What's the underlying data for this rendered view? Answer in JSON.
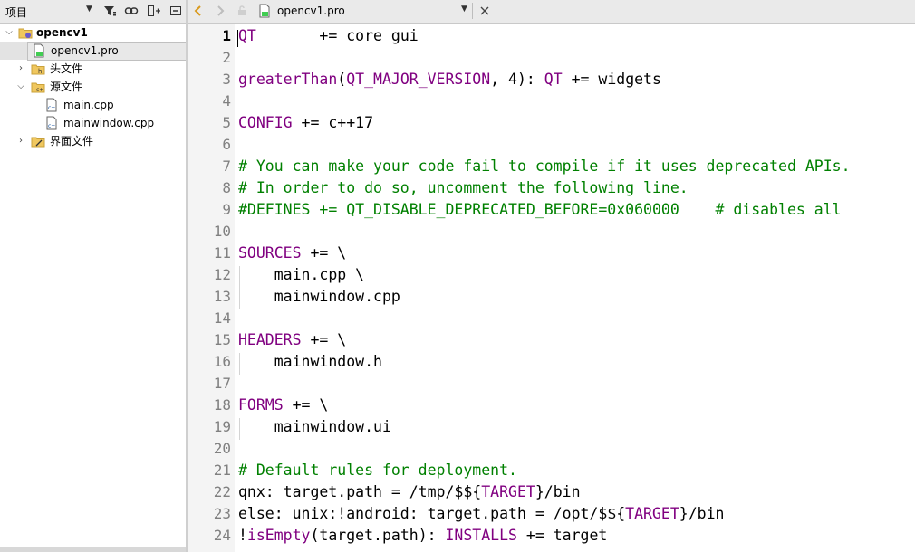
{
  "left_panel": {
    "title": "项目",
    "tree": [
      {
        "label": "opencv1"
      },
      {
        "label": "opencv1.pro"
      },
      {
        "label": "头文件"
      },
      {
        "label": "源文件"
      },
      {
        "label": "main.cpp"
      },
      {
        "label": "mainwindow.cpp"
      },
      {
        "label": "界面文件"
      }
    ]
  },
  "editor": {
    "filename": "opencv1.pro",
    "current_line": "1",
    "line_numbers": [
      "1",
      "2",
      "3",
      "4",
      "5",
      "6",
      "7",
      "8",
      "9",
      "10",
      "11",
      "12",
      "13",
      "14",
      "15",
      "16",
      "17",
      "18",
      "19",
      "20",
      "21",
      "22",
      "23",
      "24"
    ],
    "lines": [
      [
        {
          "t": "QT",
          "c": "kw"
        },
        {
          "t": "       += core gui",
          "c": ""
        }
      ],
      [],
      [
        {
          "t": "greaterThan",
          "c": "kw"
        },
        {
          "t": "(",
          "c": ""
        },
        {
          "t": "QT_MAJOR_VERSION",
          "c": "kw"
        },
        {
          "t": ", 4): ",
          "c": ""
        },
        {
          "t": "QT",
          "c": "kw"
        },
        {
          "t": " += widgets",
          "c": ""
        }
      ],
      [],
      [
        {
          "t": "CONFIG",
          "c": "kw"
        },
        {
          "t": " += c++17",
          "c": ""
        }
      ],
      [],
      [
        {
          "t": "# You can make your code fail to compile if it uses deprecated APIs.",
          "c": "cm"
        }
      ],
      [
        {
          "t": "# In order to do so, uncomment the following line.",
          "c": "cm"
        }
      ],
      [
        {
          "t": "#DEFINES += QT_DISABLE_DEPRECATED_BEFORE=0x060000    # disables all",
          "c": "cm"
        }
      ],
      [],
      [
        {
          "t": "SOURCES",
          "c": "kw"
        },
        {
          "t": " += \\",
          "c": ""
        }
      ],
      [
        {
          "t": "    main.cpp \\",
          "c": ""
        }
      ],
      [
        {
          "t": "    mainwindow.cpp",
          "c": ""
        }
      ],
      [],
      [
        {
          "t": "HEADERS",
          "c": "kw"
        },
        {
          "t": " += \\",
          "c": ""
        }
      ],
      [
        {
          "t": "    mainwindow.h",
          "c": ""
        }
      ],
      [],
      [
        {
          "t": "FORMS",
          "c": "kw"
        },
        {
          "t": " += \\",
          "c": ""
        }
      ],
      [
        {
          "t": "    mainwindow.ui",
          "c": ""
        }
      ],
      [],
      [
        {
          "t": "# Default rules for deployment.",
          "c": "cm"
        }
      ],
      [
        {
          "t": "qnx: target.path = /tmp/$${",
          "c": ""
        },
        {
          "t": "TARGET",
          "c": "kw"
        },
        {
          "t": "}/bin",
          "c": ""
        }
      ],
      [
        {
          "t": "else: unix:!android: target.path = /opt/$${",
          "c": ""
        },
        {
          "t": "TARGET",
          "c": "kw"
        },
        {
          "t": "}/bin",
          "c": ""
        }
      ],
      [
        {
          "t": "!",
          "c": ""
        },
        {
          "t": "isEmpty",
          "c": "kw"
        },
        {
          "t": "(target.path): ",
          "c": ""
        },
        {
          "t": "INSTALLS",
          "c": "kw"
        },
        {
          "t": " += target",
          "c": ""
        }
      ]
    ]
  },
  "colors": {
    "keyword": "#800080",
    "comment": "#008000",
    "text": "#000000",
    "line_number": "#808080"
  }
}
